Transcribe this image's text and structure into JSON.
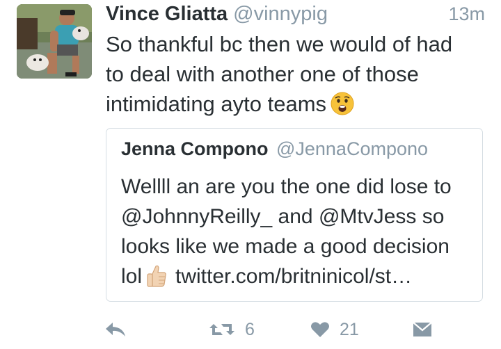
{
  "tweet": {
    "author_name": "Vince Gliatta",
    "author_handle": "@vinnypig",
    "timestamp": "13m",
    "text_lines": [
      "So thankful bc then we would of had",
      "to deal with another one of those",
      "intimidating ayto teams"
    ],
    "emoji": "fearful-face-icon"
  },
  "quoted_tweet": {
    "author_name": "Jenna Compono",
    "author_handle": "@JennaCompono",
    "text_lines": [
      "Wellll an are you the one did lose to",
      "@JohnnyReilly_ and @MtvJess so",
      "looks like we made a good decision",
      "lol"
    ],
    "emoji": "thumbs-up-icon",
    "link": "twitter.com/britninicol/st…"
  },
  "actions": {
    "reply_icon": "reply-icon",
    "retweet_icon": "retweet-icon",
    "retweet_count": "6",
    "like_icon": "heart-icon",
    "like_count": "21",
    "dm_icon": "direct-message-icon"
  },
  "colors": {
    "text": "#292f33",
    "secondary": "#8899a6",
    "border": "#d5dde3"
  }
}
